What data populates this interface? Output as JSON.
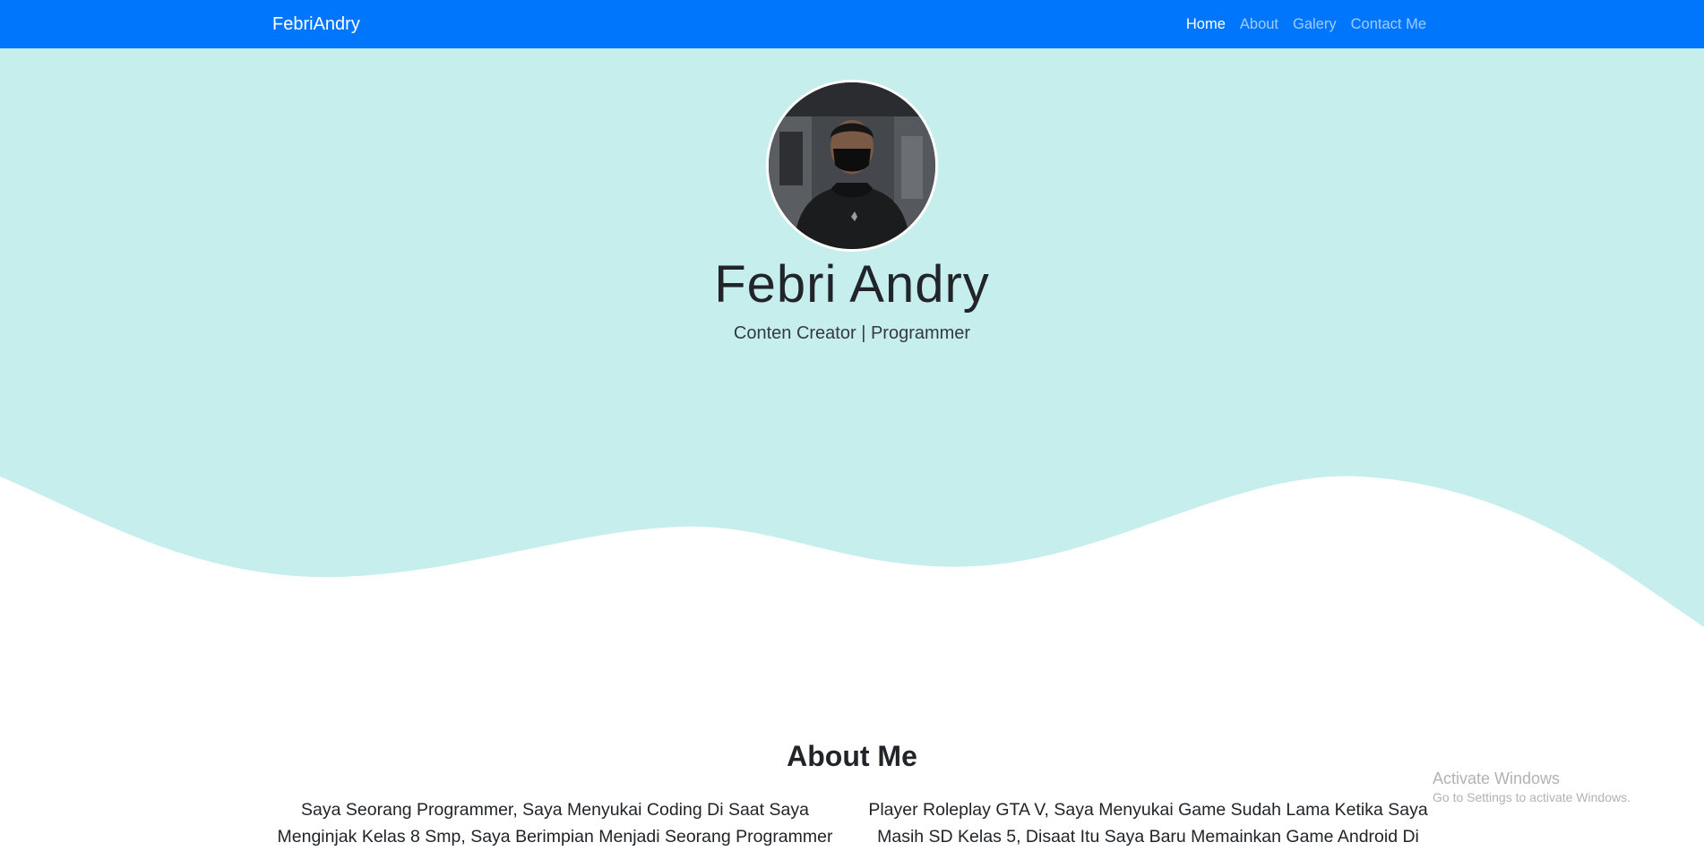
{
  "navbar": {
    "brand": "FebriAndry",
    "links": [
      {
        "label": "Home",
        "active": true
      },
      {
        "label": "About",
        "active": false
      },
      {
        "label": "Galery",
        "active": false
      },
      {
        "label": "Contact Me",
        "active": false
      }
    ],
    "background": "#0076fd"
  },
  "hero": {
    "name": "Febri Andry",
    "subtitle": "Conten Creator | Programmer",
    "background": "#c6eeec",
    "avatar_icon": "profile-photo"
  },
  "about": {
    "title": "About Me",
    "left_text": "Saya Seorang Programmer, Saya Menyukai Coding Di Saat Saya Menginjak Kelas 8 Smp, Saya Berimpian Menjadi Seorang Programmer",
    "right_text": "Player Roleplay GTA V, Saya Menyukai Game Sudah Lama Ketika Saya Masih SD Kelas 5, Disaat Itu Saya Baru Memainkan Game Android Di"
  },
  "watermark": {
    "title": "Activate Windows",
    "subtitle": "Go to Settings to activate Windows."
  }
}
